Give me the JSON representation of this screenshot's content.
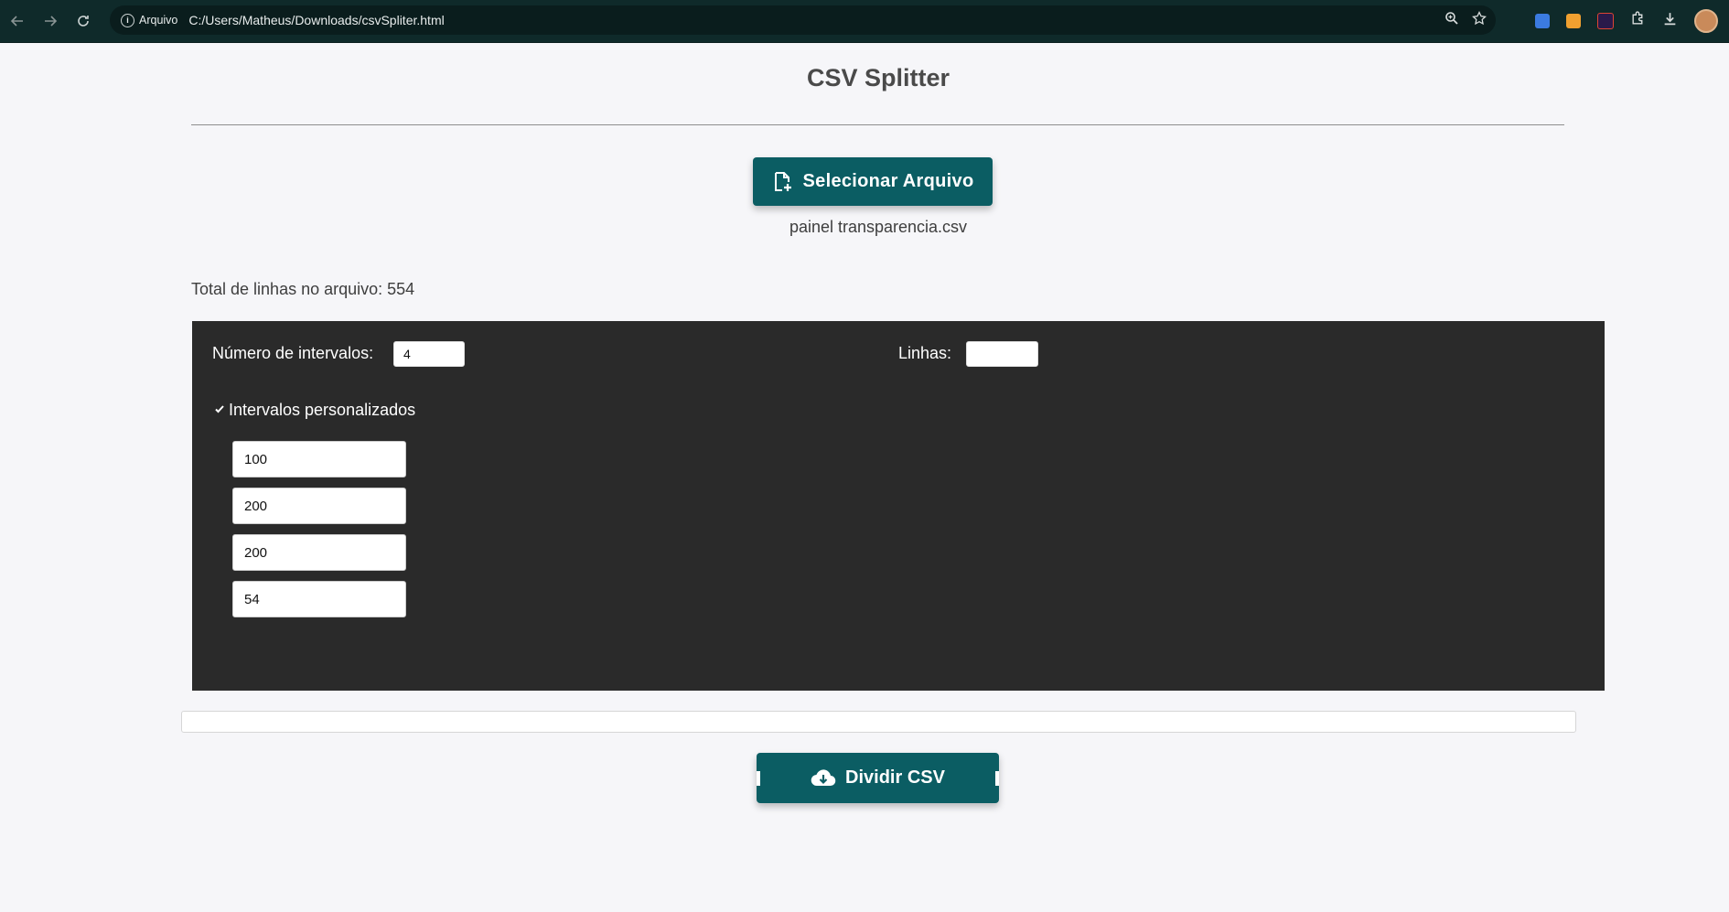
{
  "browser": {
    "site_label": "Arquivo",
    "url": "C:/Users/Matheus/Downloads/csvSpliter.html"
  },
  "page": {
    "title": "CSV Splitter",
    "select_button": "Selecionar Arquivo",
    "filename": "painel transparencia.csv",
    "total_lines": "Total de linhas no arquivo: 554"
  },
  "panel": {
    "intervals_label": "Número de intervalos:",
    "intervals_value": "4",
    "lines_label": "Linhas:",
    "lines_value": "",
    "custom_label": "Intervalos personalizados",
    "custom_checked": true,
    "intervals": [
      "100",
      "200",
      "200",
      "54"
    ]
  },
  "split_button": "Dividir CSV",
  "colors": {
    "accent": "#0b5d63",
    "panel": "#2a2a2a",
    "chrome": "#0f2a2a"
  },
  "icons": [
    "back-icon",
    "forward-icon",
    "reload-icon",
    "info-icon",
    "zoom-icon",
    "star-icon",
    "extensions-icon",
    "download-icon",
    "file-add-icon",
    "cloud-download-icon",
    "check-icon"
  ]
}
